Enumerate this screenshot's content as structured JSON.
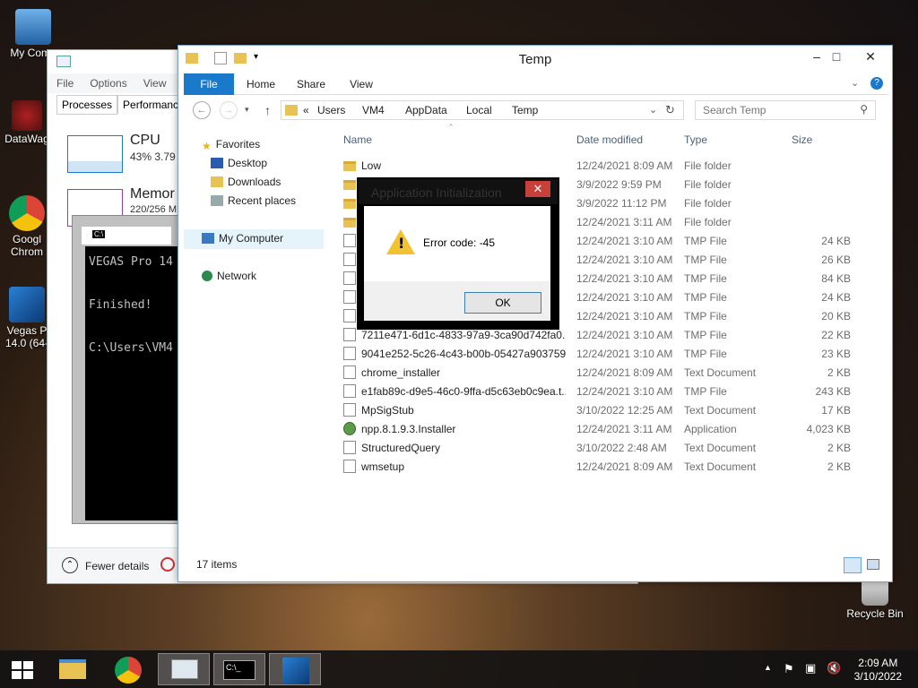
{
  "desktop": {
    "icons": [
      {
        "label": "My Comp"
      },
      {
        "label": "DataWag"
      },
      {
        "label": "Googl Chrom"
      },
      {
        "label": "Vegas P 14.0 (64-"
      },
      {
        "label": "Recycle Bin"
      }
    ]
  },
  "taskmgr": {
    "menu": [
      "File",
      "Options",
      "View"
    ],
    "tabs": [
      "Processes",
      "Performance"
    ],
    "cpu": {
      "title": "CPU",
      "stats": "43%  3.79"
    },
    "memory": {
      "title": "Memor",
      "stats": "220/256 M"
    },
    "footer": "Fewer details"
  },
  "cmd": {
    "title_icon": "C:\\",
    "lines": "VEGAS Pro 14\n\nFinished!\n\nC:\\Users\\VM4"
  },
  "explorer": {
    "title": "Temp",
    "ribbon_tabs": [
      "File",
      "Home",
      "Share",
      "View"
    ],
    "breadcrumb": [
      "«",
      "Users",
      "VM4",
      "AppData",
      "Local",
      "Temp"
    ],
    "search_placeholder": "Search Temp",
    "nav": {
      "favorites": "Favorites",
      "desktop": "Desktop",
      "downloads": "Downloads",
      "recent": "Recent places",
      "computer": "My Computer",
      "network": "Network"
    },
    "columns": {
      "name": "Name",
      "date": "Date modified",
      "type": "Type",
      "size": "Size"
    },
    "rows": [
      {
        "icon": "folder",
        "name": "Low",
        "date": "12/24/2021 8:09 AM",
        "type": "File folder",
        "size": ""
      },
      {
        "icon": "folder",
        "name": "",
        "date": "3/9/2022 9:59 PM",
        "type": "File folder",
        "size": ""
      },
      {
        "icon": "folder",
        "name": "",
        "date": "3/9/2022 11:12 PM",
        "type": "File folder",
        "size": ""
      },
      {
        "icon": "folder",
        "name": "",
        "date": "12/24/2021 3:11 AM",
        "type": "File folder",
        "size": ""
      },
      {
        "icon": "doc",
        "name": "",
        "date": "12/24/2021 3:10 AM",
        "type": "TMP File",
        "size": "24 KB"
      },
      {
        "icon": "doc",
        "name": "",
        "date": "12/24/2021 3:10 AM",
        "type": "TMP File",
        "size": "26 KB"
      },
      {
        "icon": "doc",
        "name": "",
        "date": "12/24/2021 3:10 AM",
        "type": "TMP File",
        "size": "84 KB"
      },
      {
        "icon": "doc",
        "name": "",
        "date": "12/24/2021 3:10 AM",
        "type": "TMP File",
        "size": "24 KB"
      },
      {
        "icon": "doc",
        "name": "",
        "date": "12/24/2021 3:10 AM",
        "type": "TMP File",
        "size": "20 KB"
      },
      {
        "icon": "doc",
        "name": "7211e471-6d1c-4833-97a9-3ca90d742fa0...",
        "date": "12/24/2021 3:10 AM",
        "type": "TMP File",
        "size": "22 KB"
      },
      {
        "icon": "doc",
        "name": "9041e252-5c26-4c43-b00b-05427a903759....",
        "date": "12/24/2021 3:10 AM",
        "type": "TMP File",
        "size": "23 KB"
      },
      {
        "icon": "doc",
        "name": "chrome_installer",
        "date": "12/24/2021 8:09 AM",
        "type": "Text Document",
        "size": "2 KB"
      },
      {
        "icon": "doc",
        "name": "e1fab89c-d9e5-46c0-9ffa-d5c63eb0c9ea.t...",
        "date": "12/24/2021 3:10 AM",
        "type": "TMP File",
        "size": "243 KB"
      },
      {
        "icon": "doc",
        "name": "MpSigStub",
        "date": "3/10/2022 12:25 AM",
        "type": "Text Document",
        "size": "17 KB"
      },
      {
        "icon": "app",
        "name": "npp.8.1.9.3.Installer",
        "date": "12/24/2021 3:11 AM",
        "type": "Application",
        "size": "4,023 KB"
      },
      {
        "icon": "doc",
        "name": "StructuredQuery",
        "date": "3/10/2022 2:48 AM",
        "type": "Text Document",
        "size": "2 KB"
      },
      {
        "icon": "doc",
        "name": "wmsetup",
        "date": "12/24/2021 8:09 AM",
        "type": "Text Document",
        "size": "2 KB"
      }
    ],
    "status": "17 items"
  },
  "dialog": {
    "title": "Application Initialization",
    "message": "Error code: -45",
    "ok": "OK",
    "close": "✕"
  },
  "taskbar": {
    "time": "2:09 AM",
    "date": "3/10/2022",
    "cmd_icon": "C:\\_"
  },
  "colors": {
    "accent": "#1979ca",
    "close": "#c7413a",
    "warning": "#f2c230"
  }
}
